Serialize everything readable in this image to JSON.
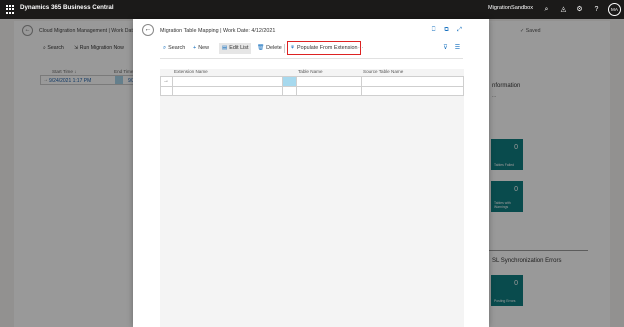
{
  "app": {
    "brand": "Dynamics 365 Business Central",
    "environment": "MigrationSandbox",
    "user_initials": "MA"
  },
  "background_page": {
    "title": "Cloud Migration Management | Work Date:",
    "saved_label": "✓ Saved",
    "toolbar": {
      "search": "Search",
      "run_migration": "Run Migration Now"
    },
    "columns": {
      "start_time": "Start Time ↓",
      "end_time": "End Time"
    },
    "row": {
      "start": "9/24/2021 1:17 PM",
      "end": "9/24/2"
    },
    "side": {
      "information": "nformation",
      "information_sub": "...",
      "tiles": [
        {
          "value": "0",
          "label": "Tables Failed"
        },
        {
          "value": "0",
          "label": "Tables with Warnings"
        }
      ],
      "errors_heading": "SL Synchronization Errors",
      "error_tile": {
        "value": "0",
        "label": "Posting Errors"
      }
    }
  },
  "dialog": {
    "title": "Migration Table Mapping | Work Date: 4/12/2021",
    "actions": {
      "search": "Search",
      "new": "New",
      "edit_list": "Edit List",
      "delete": "Delete",
      "populate": "Populate From Extension",
      "more": "···"
    },
    "columns": {
      "extension_name": "Extension Name",
      "table_name": "Table Name",
      "source_table_name": "Source Table Name"
    }
  },
  "colors": {
    "topbar": "#1b1a19",
    "accent": "#0f6cbd",
    "tile": "#0f7d80",
    "selected_cell": "#a7d9ee",
    "highlight_border": "#dd2222"
  }
}
